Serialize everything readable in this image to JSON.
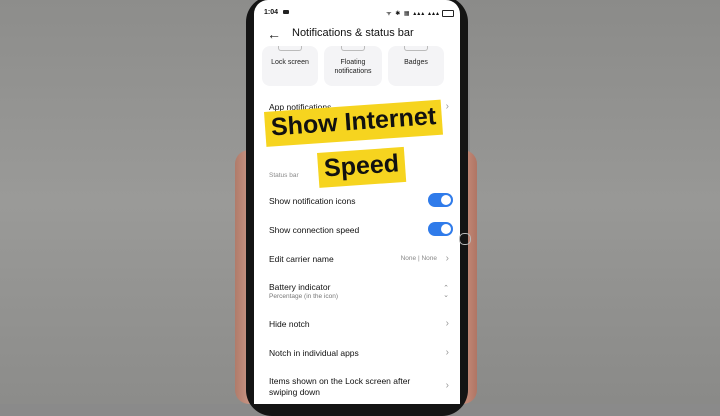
{
  "status_bar": {
    "time": "1:04",
    "icons": "ᯤ ✱ ▦ ▴▴▴ ▴▴▴"
  },
  "header": {
    "title": "Notifications & status bar",
    "back_icon": "arrow-left-icon"
  },
  "tiles": [
    {
      "label": "Lock screen"
    },
    {
      "label": "Floating notifications"
    },
    {
      "label": "Badges"
    }
  ],
  "app_notifications": {
    "label": "App notifications"
  },
  "section": {
    "label": "Status bar"
  },
  "settings": {
    "show_notification_icons": {
      "label": "Show notification icons",
      "enabled": true
    },
    "show_connection_speed": {
      "label": "Show connection speed",
      "enabled": true
    },
    "edit_carrier_name": {
      "label": "Edit carrier name",
      "value": "None | None"
    },
    "battery_indicator": {
      "label": "Battery indicator",
      "sub": "Percentage (in the icon)"
    },
    "hide_notch": {
      "label": "Hide notch"
    },
    "notch_individual": {
      "label": "Notch in individual apps"
    },
    "items_lock_screen": {
      "label": "Items shown on the Lock screen after swiping down"
    }
  },
  "overlay": {
    "line1": "Show Internet",
    "line2": "Speed",
    "color": "#f6d41f"
  },
  "colors": {
    "toggle_on": "#2f7bea"
  }
}
